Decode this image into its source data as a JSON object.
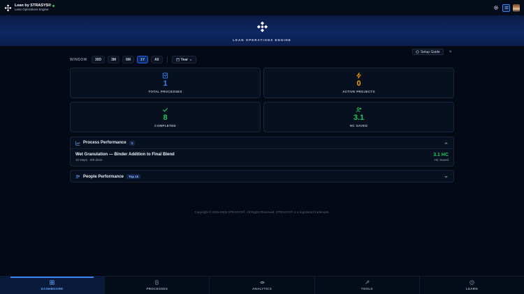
{
  "header": {
    "brand_title": "Lean by STRASYS®",
    "brand_subtitle": "Lean Operations Engine",
    "status_color": "#22c55e"
  },
  "banner": {
    "title": "LEAN OPERATIONS ENGINE"
  },
  "setup": {
    "label": "Setup Guide",
    "close": "×"
  },
  "window": {
    "label": "WINDOW",
    "options": [
      "30D",
      "3M",
      "6M",
      "1Y",
      "All"
    ],
    "selected": "1Y",
    "year_label": "Year"
  },
  "stats": [
    {
      "value": "1",
      "label": "TOTAL PROCESSES",
      "color": "#3b82f6",
      "icon": "document-icon"
    },
    {
      "value": "0",
      "label": "ACTIVE PROJECTS",
      "color": "#f59e0b",
      "icon": "lightning-icon"
    },
    {
      "value": "8",
      "label": "COMPLETED",
      "color": "#22c55e",
      "icon": "check-icon"
    },
    {
      "value": "3.1",
      "label": "HC SAVED",
      "color": "#22c55e",
      "icon": "users-icon"
    }
  ],
  "process_performance": {
    "title": "Process Performance",
    "badge": "1",
    "rows": [
      {
        "name": "Wet Granulation — Binder Addition to Final Blend",
        "meta": "10 steps · 8/8 done",
        "hc": "3.1 HC",
        "hc_label": "HC Saved"
      }
    ]
  },
  "people_performance": {
    "title": "People Performance",
    "badge": "Top 10"
  },
  "footer": {
    "copyright": "Copyright © 2025-2026 STRASYS®. All Rights Reserved. STRASYS® is a registered trademark."
  },
  "bottom_nav": [
    {
      "label": "DASHBOARD",
      "icon": "grid-icon"
    },
    {
      "label": "PROCESSES",
      "icon": "list-icon"
    },
    {
      "label": "ANALYTICS",
      "icon": "eye-icon"
    },
    {
      "label": "TOOLS",
      "icon": "wrench-icon"
    },
    {
      "label": "LEARN",
      "icon": "help-icon"
    }
  ]
}
